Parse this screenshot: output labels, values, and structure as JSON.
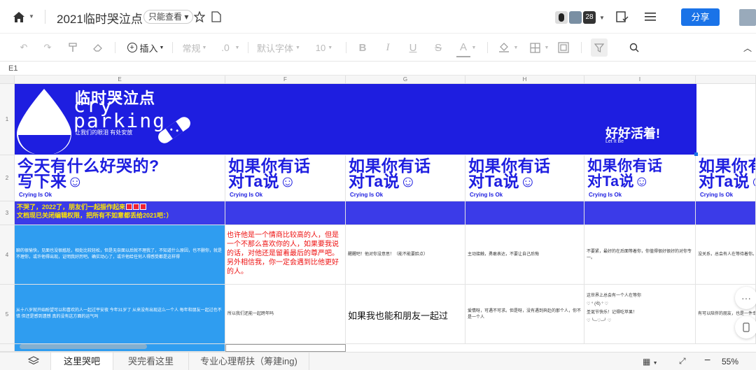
{
  "topbar": {
    "title": "2021临时哭泣点",
    "readonly": "只能查看 ▾",
    "collab_count": "28",
    "share": "分享"
  },
  "toolbar": {
    "insert": "插入",
    "format": "常规",
    "decimal": ".0",
    "font": "默认字体",
    "font_size": "10"
  },
  "namebox": "E1",
  "columns": [
    "E",
    "F",
    "G",
    "H",
    "I"
  ],
  "rows": [
    "1",
    "2",
    "3",
    "4",
    "5"
  ],
  "banner": {
    "title": "临时哭泣点",
    "cry": "cry",
    "parking": "parking",
    "slogan": "让我们的眼泪  有处安放",
    "right_title": "好好活着!",
    "right_sub": "Let It Be"
  },
  "headings": {
    "first": [
      "今天有什么好哭的?",
      "写下来☺"
    ],
    "other": [
      "如果你有话",
      "对Ta说☺"
    ],
    "sub": "Crying Is Ok"
  },
  "row3_note": {
    "line1": "不哭了，2022了，朋友们一起振作起来",
    "line2": "文档现已关闭编辑权限，把所有不如意都丢给2021吧：）"
  },
  "row4": {
    "e": "聊的很愉快，见面也没很尴尬，相处比较轻松，但是无奈面以后就不理我了，不知道什么原因，也不删你，就是不理你，或许他得出现，证明我好厉吧。确实动心了，或许他给任何人得感受都是这样得",
    "f": "也许他是一个情商比较高的人，但是一个不那么喜欢你的人，如果要我说的话，对他还是留着最后的尊严吧。另外相信我，你一定会遇到比他更好的人。",
    "g": "醒醒吧！他对你没意思！（能不能要脸点）",
    "h": "主动接触，勇敢表达，不要让自己后悔",
    "i": "不要紧，最好的在后面等着你，你值得很好很好的对你专一。",
    "j": "没关系，总会有人在等待着你。"
  },
  "row5": {
    "e": "从十八岁就开始盼望可以和喜欢的人一起过平安夜  今年31岁了  从来没有出现这么一个人 每年和朋友一起过也不错  但还是感到遗憾  真的没有这方面的运气吗",
    "f": "所以我们还能一起跨年吗",
    "g": "如果我也能和朋友一起过",
    "h": "爱情呀，可遇不可求。但是呀，没有遇到奔赴的那个人，你不是一个人",
    "i_line1": "这世界上总会有一个人在等你",
    "i_line2": "♡ ° (ᐛ)  °   ♡",
    "i_line3": "圣诞节快乐！记得吃苹果！",
    "j": "有可以陪伴的朋友，也是一件幸福的事"
  },
  "sheets": [
    "这里哭吧",
    "哭完看这里",
    "专业心理帮扶（筹建ing)"
  ],
  "zoom": "55%",
  "colors": {
    "brand_blue": "#1e1ee0",
    "row3_blue": "#3b3be8",
    "cyan": "#2f9df0",
    "share_blue": "#1a73e8",
    "red": "#e11111",
    "yellow": "#ffe600"
  }
}
